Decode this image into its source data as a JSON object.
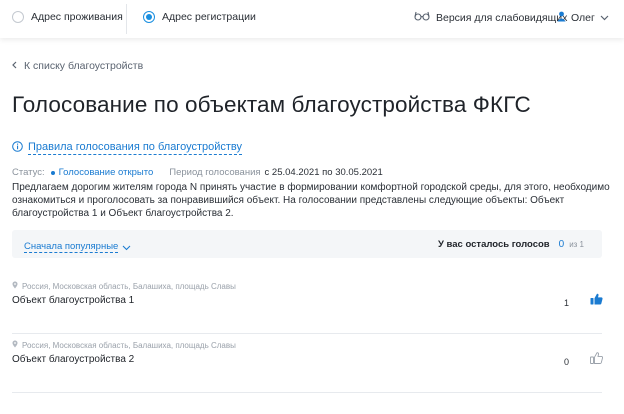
{
  "topbar": {
    "radio_living": "Адрес проживания",
    "radio_registration": "Адрес регистрации",
    "access_version": "Версия для слабовидящих",
    "user_name": "Олег"
  },
  "back_link": "К списку благоустройств",
  "page_title": "Голосование по объектам благоустройства ФКГС",
  "rules_link": "Правила голосования по благоустройству",
  "status": {
    "label": "Статус:",
    "value": "Голосование открыто",
    "period_label": "Период голосования",
    "period_value": "с 25.04.2021 по 30.05.2021"
  },
  "description": "Предлагаем дорогим жителям города N принять участие в формировании комфортной городской среды, для этого, необходимо ознакомиться и проголосовать за понравившийся объект. На голосовании представлены следующие объекты: Объект благоустройства 1 и Объект благоустройства 2.",
  "filter": {
    "sort_label": "Сначала популярные",
    "votes_left_label": "У вас осталось голосов",
    "votes_left_value": "0",
    "votes_total": "из 1"
  },
  "items": [
    {
      "location": "Россия, Московская область, Балашиха, площадь Славы",
      "name": "Объект благоустройства 1",
      "votes": "1",
      "liked": true
    },
    {
      "location": "Россия, Московская область, Балашиха, площадь Славы",
      "name": "Объект благоустройства 2",
      "votes": "0",
      "liked": false
    }
  ],
  "colors": {
    "accent": "#1a7bd1",
    "radio_active": "#1a8fe0",
    "muted": "#8a929c",
    "text": "#1f2329"
  }
}
